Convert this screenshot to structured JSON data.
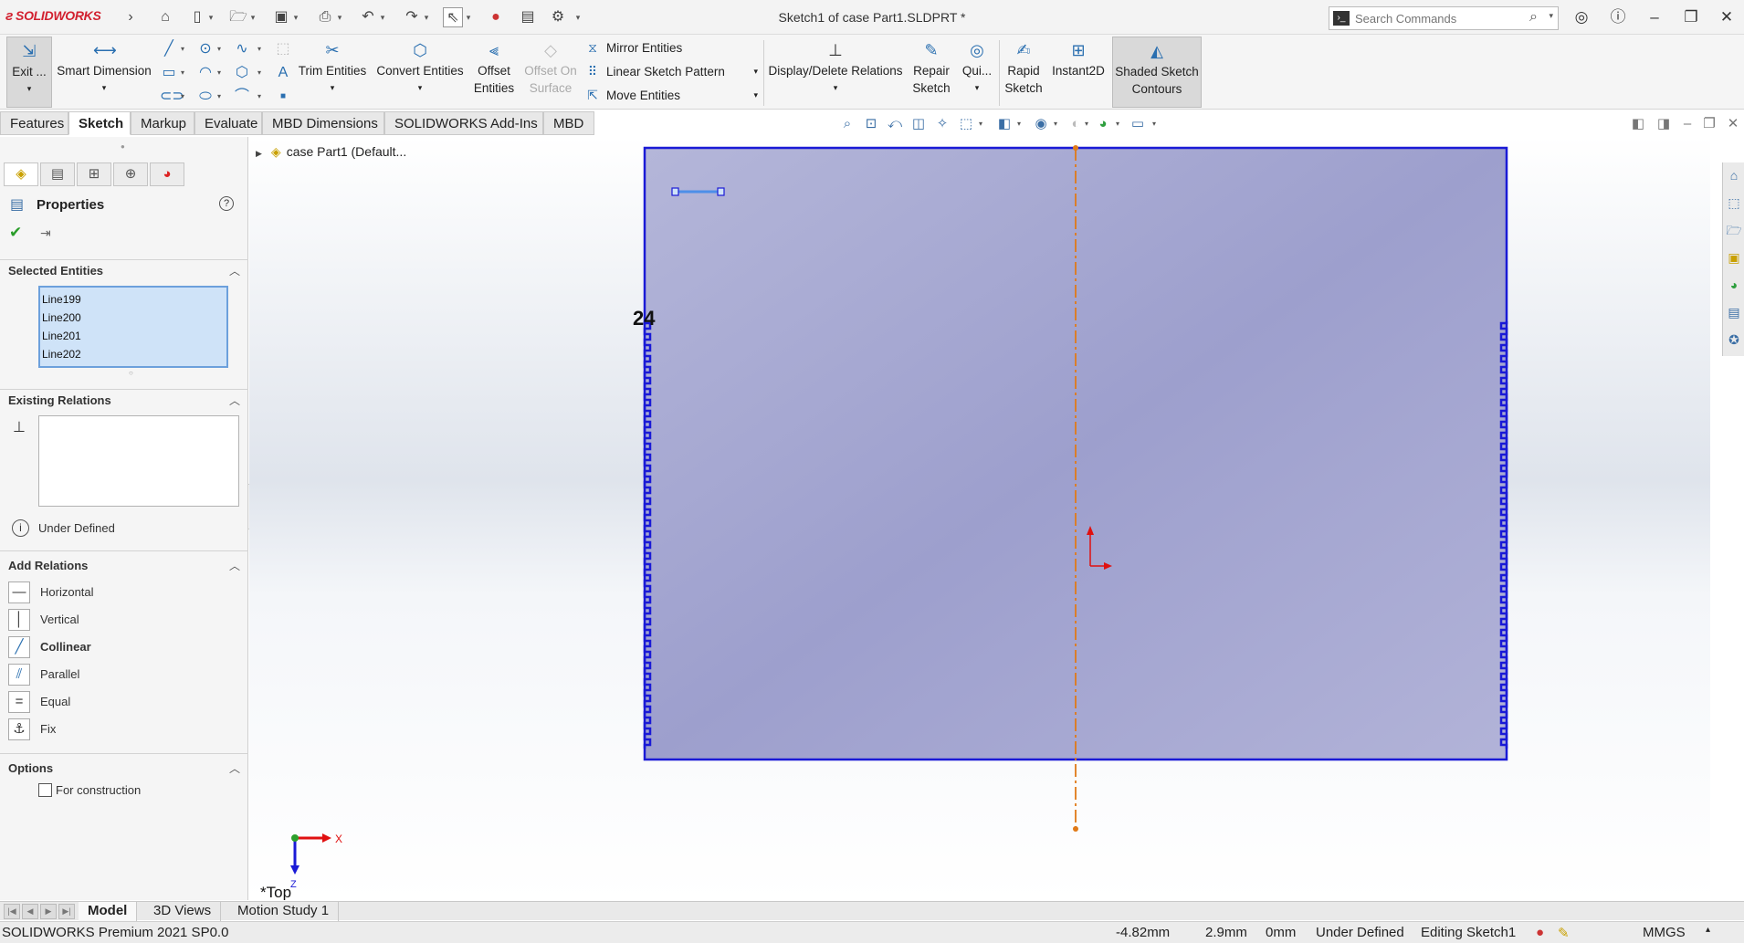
{
  "titlebar": {
    "brand": "SOLIDWORKS",
    "document_title": "Sketch1 of case Part1.SLDPRT *",
    "search_placeholder": "Search Commands",
    "quick_access_icons": [
      "home-icon",
      "new-icon",
      "open-icon",
      "save-icon",
      "print-icon",
      "undo-icon",
      "redo-icon",
      "select-icon",
      "rebuild-icon",
      "file-properties-icon",
      "options-icon"
    ],
    "window_controls": [
      "account-icon",
      "help-icon",
      "minimize-icon",
      "restore-icon",
      "close-icon"
    ]
  },
  "command_manager": {
    "exit_sketch": "Exit ...",
    "smart_dimension": "Smart Dimension",
    "trim_entities": "Trim Entities",
    "convert_entities": "Convert Entities",
    "offset_entities_1": "Offset",
    "offset_entities_2": "Entities",
    "offset_on_surface_1": "Offset On",
    "offset_on_surface_2": "Surface",
    "mirror_entities": "Mirror Entities",
    "linear_sketch_pattern": "Linear Sketch Pattern",
    "move_entities": "Move Entities",
    "display_delete_relations": "Display/Delete Relations",
    "repair_sketch_1": "Repair",
    "repair_sketch_2": "Sketch",
    "quick_snaps": "Qui...",
    "rapid_sketch_1": "Rapid",
    "rapid_sketch_2": "Sketch",
    "instant2d": "Instant2D",
    "shaded_contours_1": "Shaded Sketch",
    "shaded_contours_2": "Contours"
  },
  "tabs": [
    {
      "label": "Features",
      "active": false
    },
    {
      "label": "Sketch",
      "active": true
    },
    {
      "label": "Markup",
      "active": false
    },
    {
      "label": "Evaluate",
      "active": false
    },
    {
      "label": "MBD Dimensions",
      "active": false
    },
    {
      "label": "SOLIDWORKS Add-Ins",
      "active": false
    },
    {
      "label": "MBD",
      "active": false
    }
  ],
  "property_manager": {
    "title": "Properties",
    "selected_entities": {
      "title": "Selected Entities",
      "items": [
        "Line199",
        "Line200",
        "Line201",
        "Line202"
      ]
    },
    "existing_relations": {
      "title": "Existing Relations",
      "status": "Under Defined"
    },
    "add_relations": {
      "title": "Add Relations",
      "items": [
        {
          "label": "Horizontal",
          "icon": "horizontal-icon",
          "bold": false
        },
        {
          "label": "Vertical",
          "icon": "vertical-icon",
          "bold": false
        },
        {
          "label": "Collinear",
          "icon": "collinear-icon",
          "bold": true
        },
        {
          "label": "Parallel",
          "icon": "parallel-icon",
          "bold": false
        },
        {
          "label": "Equal",
          "icon": "equal-icon",
          "bold": false
        },
        {
          "label": "Fix",
          "icon": "fix-icon",
          "bold": false
        }
      ]
    },
    "options": {
      "title": "Options",
      "for_construction": "For construction",
      "for_construction_checked": false
    }
  },
  "feature_tree": {
    "root": "case Part1  (Default..."
  },
  "graphics": {
    "dimension_value": "24",
    "view_label": "*Top",
    "triad_x": "X",
    "triad_z": "Z",
    "sketch_fill": "#a8a8d3",
    "sketch_line": "#1a1ad6",
    "centerline": "#e07a18"
  },
  "bottom_tabs": [
    {
      "label": "Model",
      "active": true
    },
    {
      "label": "3D Views",
      "active": false
    },
    {
      "label": "Motion Study 1",
      "active": false
    }
  ],
  "status_bar": {
    "product": "SOLIDWORKS Premium 2021 SP0.0",
    "x": "-4.82mm",
    "y": "2.9mm",
    "z": "0mm",
    "definition": "Under Defined",
    "editing": "Editing Sketch1",
    "units": "MMGS"
  }
}
